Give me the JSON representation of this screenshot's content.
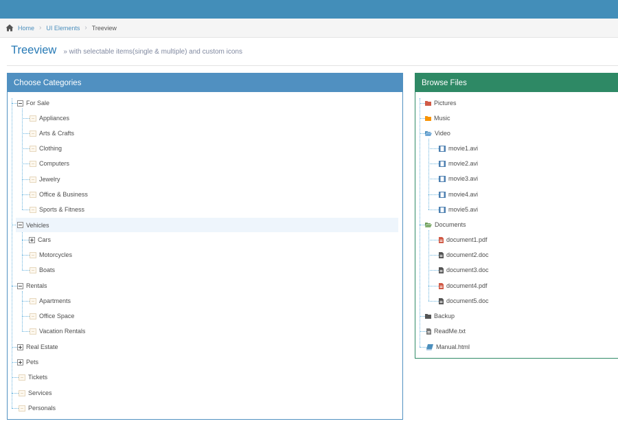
{
  "breadcrumbs": {
    "items": [
      "Home",
      "UI Elements"
    ],
    "active": "Treeview"
  },
  "page": {
    "title": "Treeview",
    "subtitle": "» with selectable items(single & multiple) and custom icons"
  },
  "categories": {
    "title": "Choose Categories",
    "for_sale": "For Sale",
    "for_sale_items": [
      "Appliances",
      "Arts & Crafts",
      "Clothing",
      "Computers",
      "Jewelry",
      "Office & Business",
      "Sports & Fitness"
    ],
    "vehicles": "Vehicles",
    "cars": "Cars",
    "vehicle_items": [
      "Motorcycles",
      "Boats"
    ],
    "rentals": "Rentals",
    "rental_items": [
      "Apartments",
      "Office Space",
      "Vacation Rentals"
    ],
    "real_estate": "Real Estate",
    "pets": "Pets",
    "bottom_items": [
      "Tickets",
      "Services",
      "Personals"
    ]
  },
  "files": {
    "title": "Browse Files",
    "pictures": "Pictures",
    "music": "Music",
    "video": "Video",
    "videos": [
      "movie1.avi",
      "movie2.avi",
      "movie3.avi",
      "movie4.avi",
      "movie5.avi"
    ],
    "documents": "Documents",
    "docs": [
      "document1.pdf",
      "document2.doc",
      "document3.doc",
      "document4.pdf",
      "document5.doc"
    ],
    "backup": "Backup",
    "readme": "ReadMe.txt",
    "manual": "Manual.html"
  },
  "colors": {
    "topbar": "#438eb9",
    "categories_header": "#5090c1",
    "files_header": "#2e8965",
    "pictures_folder": "#d15b47",
    "music_folder": "#f89406",
    "video_folder": "#4c8fbd",
    "documents_folder": "#82af6f",
    "backup_folder": "#555555",
    "pdf_icon": "#d15b47"
  }
}
